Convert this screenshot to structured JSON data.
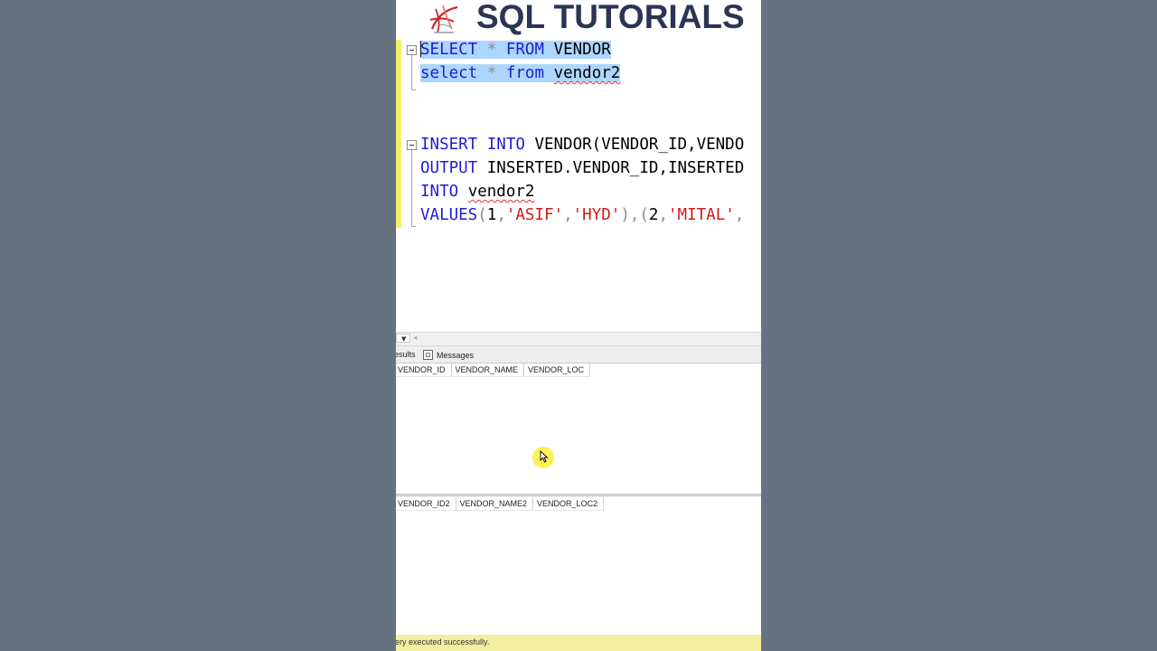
{
  "banner": {
    "title": "SQL TUTORIALS",
    "logo_icon": "sql-server-logo-icon"
  },
  "editor": {
    "line1": [
      "SELECT",
      "*",
      "FROM",
      "VENDOR"
    ],
    "line2": [
      "select",
      "*",
      "from",
      "vendor2"
    ],
    "line5": {
      "kw": "INSERT INTO",
      "rest": "VENDOR(VENDOR_ID,VENDO"
    },
    "line6": {
      "kw": "OUTPUT",
      "rest": "INSERTED.VENDOR_ID,INSERTED"
    },
    "line7": {
      "kw": "INTO",
      "table": "vendor2"
    },
    "line8": {
      "kw": "VALUES",
      "n1": "1",
      "s1": "'ASIF'",
      "s2": "'HYD'",
      "n2": "2",
      "s3": "'MITAL'"
    }
  },
  "results": {
    "tabs": {
      "results": "esults",
      "messages": "Messages"
    },
    "grid1_columns": [
      "VENDOR_ID",
      "VENDOR_NAME",
      "VENDOR_LOC"
    ],
    "grid2_columns": [
      "VENDOR_ID2",
      "VENDOR_NAME2",
      "VENDOR_LOC2"
    ]
  },
  "status": {
    "text": "ery executed successfully."
  },
  "colors": {
    "keyword": "#1d1dd6",
    "string": "#cc1b1b",
    "selection": "#add6ff",
    "status_bar": "#f4eea0",
    "banner_text": "#2b3553"
  }
}
